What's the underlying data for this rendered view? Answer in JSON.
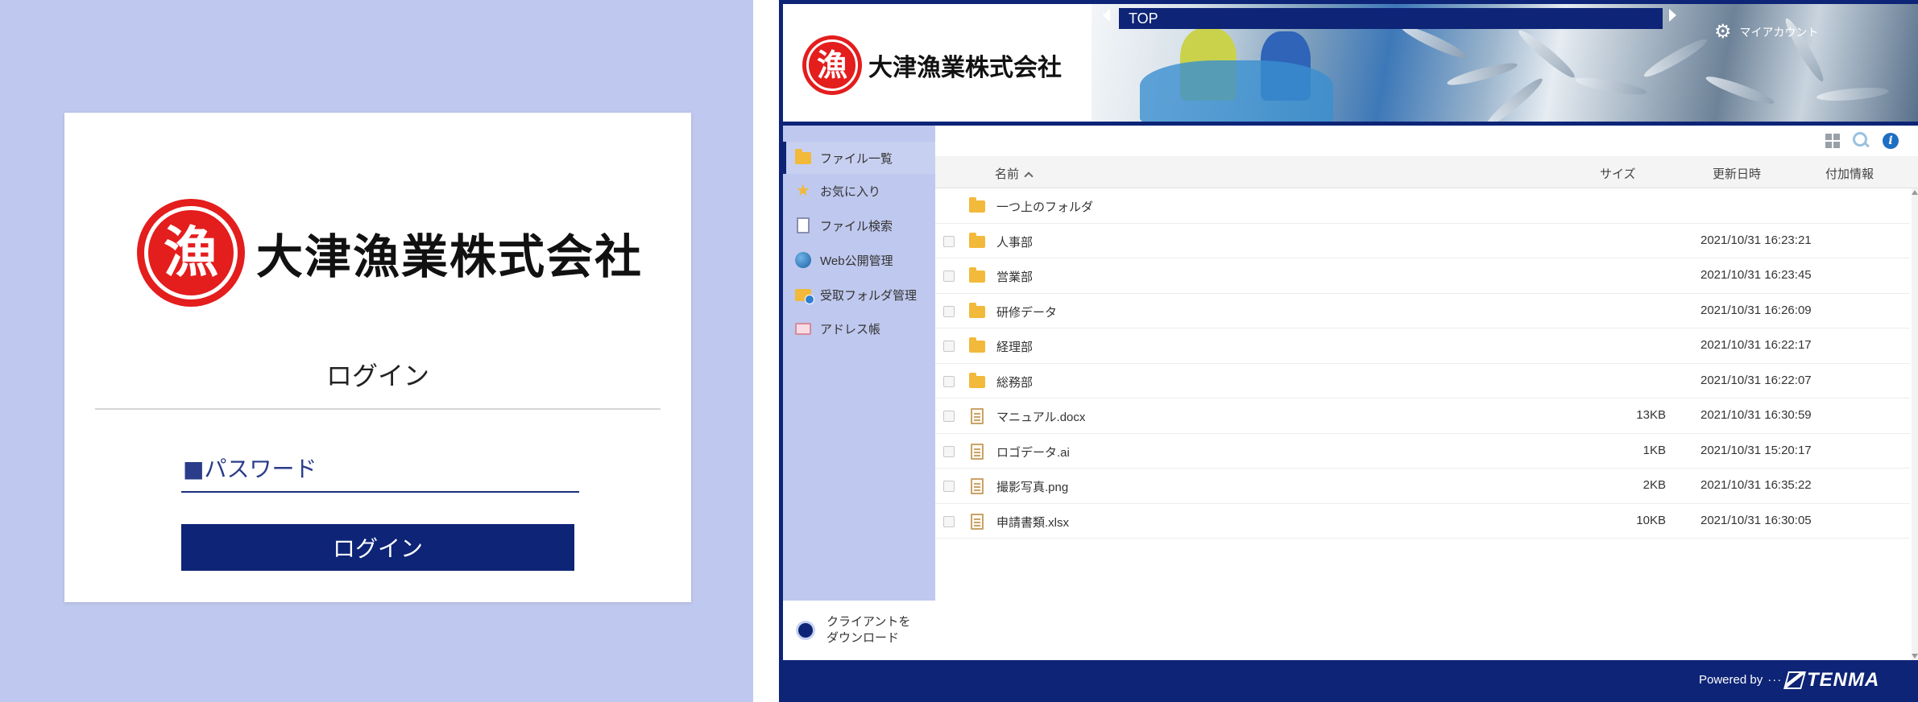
{
  "login": {
    "company_logo_text": "大津漁業株式会社",
    "seal_char": "漁",
    "title": "ログイン",
    "password_placeholder": "■パスワード",
    "button_label": "ログイン"
  },
  "app": {
    "company_logo_text": "大津漁業株式会社",
    "seal_char": "漁",
    "breadcrumb": "TOP",
    "account_label": "マイアカウント",
    "sidebar": {
      "items": [
        {
          "label": "ファイル一覧",
          "icon": "folder-icon",
          "active": true
        },
        {
          "label": "お気に入り",
          "icon": "star-icon",
          "active": false
        },
        {
          "label": "ファイル検索",
          "icon": "file-search-icon",
          "active": false
        },
        {
          "label": "Web公開管理",
          "icon": "globe-icon",
          "active": false
        },
        {
          "label": "受取フォルダ管理",
          "icon": "receive-folder-icon",
          "active": false
        },
        {
          "label": "アドレス帳",
          "icon": "address-book-icon",
          "active": false
        }
      ],
      "download_label": "クライアントを ダウンロード"
    },
    "table": {
      "headers": {
        "name": "名前",
        "size": "サイズ",
        "date": "更新日時",
        "extra": "付加情報"
      },
      "up_folder": "一つ上のフォルダ",
      "rows": [
        {
          "name": "人事部",
          "type": "folder",
          "size": "",
          "date": "2021/10/31 16:23:21"
        },
        {
          "name": "営業部",
          "type": "folder",
          "size": "",
          "date": "2021/10/31 16:23:45"
        },
        {
          "name": "研修データ",
          "type": "folder",
          "size": "",
          "date": "2021/10/31 16:26:09"
        },
        {
          "name": "経理部",
          "type": "folder",
          "size": "",
          "date": "2021/10/31 16:22:17"
        },
        {
          "name": "総務部",
          "type": "folder",
          "size": "",
          "date": "2021/10/31 16:22:07"
        },
        {
          "name": "マニュアル.docx",
          "type": "file",
          "size": "13KB",
          "date": "2021/10/31 16:30:59"
        },
        {
          "name": "ロゴデータ.ai",
          "type": "file",
          "size": "1KB",
          "date": "2021/10/31 15:20:17"
        },
        {
          "name": "撮影写真.png",
          "type": "file",
          "size": "2KB",
          "date": "2021/10/31 16:35:22"
        },
        {
          "name": "申請書類.xlsx",
          "type": "file",
          "size": "10KB",
          "date": "2021/10/31 16:30:05"
        }
      ]
    },
    "footer": {
      "powered_by": "Powered by",
      "dots": "···",
      "brand": "TENMA"
    }
  },
  "colors": {
    "navy": "#0d2477",
    "panel_blue": "#bfc8ee",
    "seal_red": "#e41d1d",
    "folder_yellow": "#f2b93a"
  }
}
